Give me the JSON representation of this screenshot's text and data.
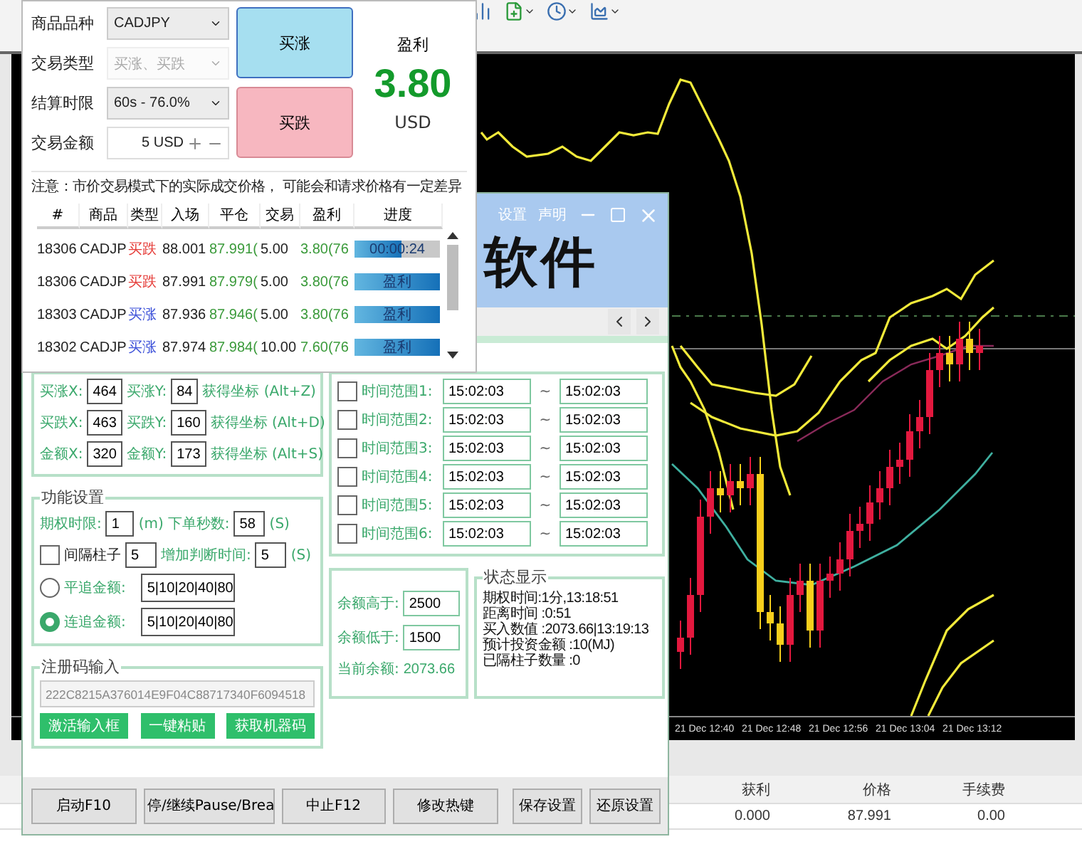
{
  "chart": {
    "time_labels": [
      "21 Dec 12:40",
      "21 Dec 12:48",
      "21 Dec 12:56",
      "21 Dec 13:04",
      "21 Dec 13:12"
    ]
  },
  "terminal": {
    "columns": [
      "获利",
      "价格",
      "手续费"
    ],
    "row": [
      "0.000",
      "87.991",
      "0.00"
    ]
  },
  "trade": {
    "fields": [
      {
        "label": "商品品种",
        "value": "CADJPY",
        "kind": "select",
        "disabled": false
      },
      {
        "label": "交易类型",
        "value": "买涨、买跌",
        "kind": "select",
        "disabled": true
      },
      {
        "label": "结算时限",
        "value": "60s - 76.0%",
        "kind": "select",
        "disabled": false
      },
      {
        "label": "交易金额",
        "value": "5 USD",
        "kind": "amount",
        "disabled": false
      }
    ],
    "buttons": [
      {
        "label": "买涨",
        "kind": "rise"
      },
      {
        "label": "买跌",
        "kind": "fall"
      }
    ],
    "profit": {
      "label": "盈利",
      "value": "3.80",
      "currency": "USD"
    },
    "notice": "注意：市价交易模式下的实际成交价格， 可能会和请求价格有一定差异",
    "table": {
      "columns": [
        "#",
        "商品",
        "类型",
        "入场",
        "平仓",
        "交易",
        "盈利",
        "进度"
      ],
      "rows": [
        {
          "id": "18306",
          "symbol": "CADJP",
          "type": "买跌",
          "color": "#e53935",
          "open": "88.001",
          "close": "87.991(",
          "amount": "5.00",
          "profit": "3.80(76",
          "progress": "00:00:24",
          "level": 0.55
        },
        {
          "id": "18306",
          "symbol": "CADJP",
          "type": "买跌",
          "color": "#e53935",
          "open": "87.991",
          "close": "87.979(",
          "amount": "5.00",
          "profit": "3.80(76",
          "progress": "盈利",
          "level": 1
        },
        {
          "id": "18303",
          "symbol": "CADJP",
          "type": "买涨",
          "color": "#3a4fd8",
          "open": "87.936",
          "close": "87.946(",
          "amount": "5.00",
          "profit": "3.80(76",
          "progress": "盈利",
          "level": 1
        },
        {
          "id": "18302",
          "symbol": "CADJP",
          "type": "买涨",
          "color": "#3a4fd8",
          "open": "87.974",
          "close": "87.984(",
          "amount": "10.00",
          "profit": "7.60(76",
          "progress": "盈利",
          "level": 1
        }
      ]
    }
  },
  "app": {
    "banner": "软件",
    "menu": [
      "设置",
      "声明"
    ],
    "coords": [
      {
        "x_label": "买涨X:",
        "x_value": "464",
        "y_label": "买涨Y:",
        "y_value": "84",
        "action": "获得坐标 (Alt+Z)"
      },
      {
        "x_label": "买跌X:",
        "x_value": "463",
        "y_label": "买跌Y:",
        "y_value": "160",
        "action": "获得坐标 (Alt+D)"
      },
      {
        "x_label": "金额X:",
        "x_value": "320",
        "y_label": "金额Y:",
        "y_value": "173",
        "action": "获得坐标 (Alt+S)"
      }
    ],
    "function": {
      "title": "功能设置",
      "period": {
        "label": "期权时限:",
        "value": "1",
        "unit": "(m)"
      },
      "seconds": {
        "label": "下单秒数:",
        "value": "58",
        "unit": "(S)"
      },
      "interval": {
        "label": "间隔柱子",
        "checked": false,
        "value": "5"
      },
      "extra_time": {
        "label": "增加判断时间:",
        "value": "5",
        "unit": "(S)"
      },
      "modes": [
        {
          "label": "平追金额:",
          "value": "5|10|20|40|80",
          "selected": false
        },
        {
          "label": "连追金额:",
          "value": "5|10|20|40|80",
          "selected": true
        }
      ]
    },
    "register": {
      "title": "注册码输入",
      "code": "222C8215A376014E9F04C88717340F6094518",
      "buttons": [
        "激活输入框",
        "一键粘贴",
        "获取机器码"
      ]
    },
    "time_ranges": [
      {
        "label": "时间范围1:",
        "checked": false,
        "from": "15:02:03",
        "separator": "~",
        "to": "15:02:03"
      },
      {
        "label": "时间范围2:",
        "checked": false,
        "from": "15:02:03",
        "separator": "~",
        "to": "15:02:03"
      },
      {
        "label": "时间范围3:",
        "checked": false,
        "from": "15:02:03",
        "separator": "~",
        "to": "15:02:03"
      },
      {
        "label": "时间范围4:",
        "checked": false,
        "from": "15:02:03",
        "separator": "~",
        "to": "15:02:03"
      },
      {
        "label": "时间范围5:",
        "checked": false,
        "from": "15:02:03",
        "separator": "~",
        "to": "15:02:03"
      },
      {
        "label": "时间范围6:",
        "checked": false,
        "from": "15:02:03",
        "separator": "~",
        "to": "15:02:03"
      }
    ],
    "balance": {
      "rows": [
        {
          "label": "余额高于:",
          "value": "2500"
        },
        {
          "label": "余额低于:",
          "value": "1500"
        }
      ],
      "current": {
        "label": "当前余额:",
        "value": "2073.66"
      }
    },
    "status": {
      "title": "状态显示",
      "lines": [
        "期权时间:1分,13:18:51",
        "距离时间 :0:51",
        "买入数值 :2073.66|13:19:13",
        "预计投资金额 :10(MJ)",
        "已隔柱子数量 :0"
      ]
    },
    "buttons": [
      {
        "label": "启动F10",
        "kind": "control"
      },
      {
        "label": "停/继续Pause/Brea",
        "kind": "control"
      },
      {
        "label": "中止F12",
        "kind": "control"
      },
      {
        "label": "修改热键",
        "kind": "control"
      },
      {
        "label": "保存设置",
        "kind": "settings"
      },
      {
        "label": "还原设置",
        "kind": "settings"
      }
    ]
  }
}
